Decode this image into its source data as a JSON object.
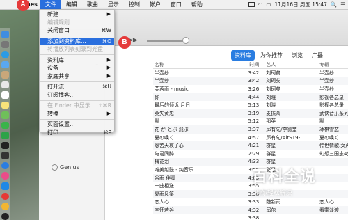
{
  "menubar": {
    "app_name": "nes",
    "items": [
      "文件",
      "编辑",
      "歌曲",
      "显示",
      "控制",
      "帐户",
      "窗口",
      "帮助"
    ],
    "datetime": "11月16日 周五 15:47",
    "search_glyph": "🔍",
    "list_glyph": "☰"
  },
  "badges": {
    "a": "A",
    "b": "B"
  },
  "file_menu": {
    "items": [
      {
        "label": "新建",
        "arrow": "▶",
        "state": "normal"
      },
      {
        "label": "编辑规则",
        "state": "disabled"
      },
      {
        "label": "关闭窗口",
        "shortcut": "⌘W",
        "state": "normal"
      },
      {
        "label": "添加到资料库...",
        "shortcut": "⌘O",
        "state": "highlighted"
      },
      {
        "label": "将播放列表刻录到光盘",
        "state": "disabled"
      },
      {
        "label": "资料库",
        "arrow": "▶",
        "state": "normal"
      },
      {
        "label": "设备",
        "arrow": "▶",
        "state": "normal"
      },
      {
        "label": "家庭共享",
        "arrow": "▶",
        "state": "normal"
      },
      {
        "label": "打开流...",
        "shortcut": "⌘U",
        "state": "normal"
      },
      {
        "label": "订阅播客...",
        "state": "normal"
      },
      {
        "label": "在 Finder 中显示",
        "shortcut": "⇧⌘R",
        "state": "disabled"
      },
      {
        "label": "转换",
        "arrow": "▶",
        "state": "normal"
      },
      {
        "label": "页面设置...",
        "state": "normal"
      },
      {
        "label": "打印...",
        "shortcut": "⌘P",
        "state": "normal"
      }
    ]
  },
  "toolbar": {
    "apple_glyph": "",
    "play_glyph": "▶▶"
  },
  "view_tabs": [
    "资料库",
    "为你推荐",
    "浏览",
    "广播"
  ],
  "sidebar": {
    "genius_label": "Genius"
  },
  "table": {
    "headers": {
      "name": "名称",
      "time": "时间",
      "artist": "艺人",
      "album": "专辑"
    },
    "rows": [
      {
        "name": "半壶纱",
        "time": "3:42",
        "artist": "刘珂矣",
        "album": "半壶纱"
      },
      {
        "name": "半壶纱",
        "time": "3:42",
        "artist": "刘珂矣",
        "album": "半壶纱"
      },
      {
        "name": "芙蓉雨 - music",
        "time": "3:26",
        "artist": "刘珂矣",
        "album": "半壶纱"
      },
      {
        "name": "你",
        "time": "4:44",
        "artist": "刘晓",
        "album": "影视各总录"
      },
      {
        "name": "最后的倾诉 月日",
        "time": "5:13",
        "artist": "刘晓",
        "album": "影视各总录"
      },
      {
        "name": "英失黄忠",
        "time": "3:19",
        "artist": "麦振鸿",
        "album": "武侠音乐系列之..."
      },
      {
        "name": "默",
        "time": "5:12",
        "artist": "那英",
        "album": "默"
      },
      {
        "name": "花 が とぶ 飛ぶ",
        "time": "3:37",
        "artist": "邱有句/李德奎",
        "album": "冰棋雪恋"
      },
      {
        "name": "夏の唤く",
        "time": "4:57",
        "artist": "邱有句/AirS1991",
        "album": "夏の唤く"
      },
      {
        "name": "怨苦天哀了心",
        "time": "4:21",
        "artist": "群星",
        "album": "传世情歌.女声试..."
      },
      {
        "name": "与君同醉",
        "time": "2:29",
        "artist": "群星",
        "album": "幻想三国志4外传"
      },
      {
        "name": "梅花泪",
        "time": "4:33",
        "artist": "群星",
        "album": ""
      },
      {
        "name": "唯美越鼓 - 纯音乐",
        "time": "3:56",
        "artist": "群星",
        "album": ""
      },
      {
        "name": "谷雨 伴奏",
        "time": "4:05",
        "artist": "",
        "album": ""
      },
      {
        "name": "一曲相送",
        "time": "3:55",
        "artist": "",
        "album": ""
      },
      {
        "name": "夏雨风筝",
        "time": "3:38",
        "artist": "",
        "album": ""
      },
      {
        "name": "恋人心",
        "time": "3:33",
        "artist": "魏新雨",
        "album": "恋人心"
      },
      {
        "name": "空怀若谷",
        "time": "4:32",
        "artist": "邱尔",
        "album": "看雾淡渡"
      },
      {
        "name": "",
        "time": "3:38",
        "artist": "",
        "album": ""
      }
    ]
  },
  "watermark": {
    "title": "百科全说",
    "subtitle": "助你轻松解决"
  }
}
